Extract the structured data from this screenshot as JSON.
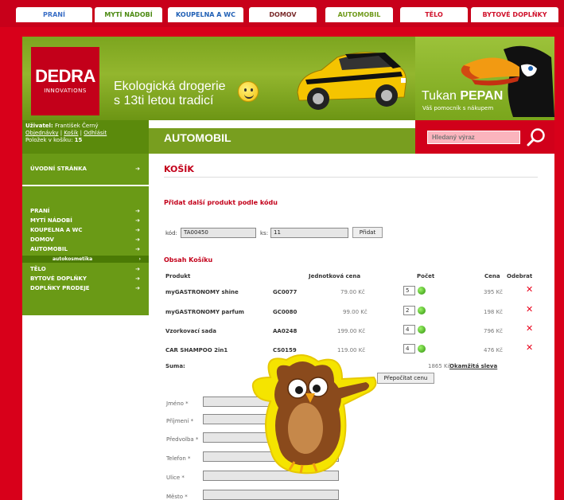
{
  "top_nav": [
    {
      "label": "PRANÍ",
      "color": "#3b6fc6"
    },
    {
      "label": "MYTÍ NÁDOBÍ",
      "color": "#4c8a12"
    },
    {
      "label": "KOUPELNA A WC",
      "color": "#1f5fb5"
    },
    {
      "label": "DOMOV",
      "color": "#7a2b2b"
    },
    {
      "label": "AUTOMOBIL",
      "color": "#6f9a1a"
    },
    {
      "label": "TĚLO",
      "color": "#d0112b"
    },
    {
      "label": "BYTOVÉ DOPLŇKY",
      "color": "#d0112b"
    }
  ],
  "logo": {
    "brand": "DEDRA",
    "sub": "INNOVATIONS"
  },
  "slogan": {
    "line1": "Ekologická drogerie",
    "line2": "s 13ti letou tradicí"
  },
  "toucan": {
    "title_light": "Tukan ",
    "title_bold": "PEPAN",
    "subtitle": "Váš pomocník s nákupem"
  },
  "user": {
    "label": "Uživatel:",
    "name": "František Černý",
    "links": [
      "Objednávky",
      "Košík",
      "Odhlásit"
    ],
    "cart_label": "Položek v košíku:",
    "cart_count": "15"
  },
  "section_title": "AUTOMOBIL",
  "search": {
    "placeholder": "Hledaný výraz"
  },
  "sidebar": {
    "home": "ÚVODNÍ STRÁNKA",
    "items": [
      "PRANÍ",
      "MYTÍ NÁDOBÍ",
      "KOUPELNA A WC",
      "DOMOV",
      "AUTOMOBIL"
    ],
    "subitem": "autokosmetika",
    "items2": [
      "TĚLO",
      "BYTOVÉ DOPLŇKY",
      "DOPLŇKY PRODEJE"
    ],
    "arrow": "➔"
  },
  "cart": {
    "title": "KOŠÍK",
    "add_heading": "Přidat další produkt podle kódu",
    "code_label": "kód:",
    "code_value": "TA00450",
    "qty_label": "ks:",
    "qty_value": "11",
    "add_button": "Přidat",
    "contents_heading": "Obsah Košíku",
    "headers": {
      "product": "Produkt",
      "unit_price": "Jednotková cena",
      "count": "Počet",
      "price": "Cena",
      "remove": "Odebrat"
    },
    "rows": [
      {
        "name": "myGASTRONOMY shine",
        "code": "GC0077",
        "unit": "79.00 Kč",
        "qty": "5",
        "price": "395 Kč"
      },
      {
        "name": "myGASTRONOMY parfum",
        "code": "GC0080",
        "unit": "99.00 Kč",
        "qty": "2",
        "price": "198 Kč"
      },
      {
        "name": "Vzorkovací sada",
        "code": "AA0248",
        "unit": "199.00 Kč",
        "qty": "4",
        "price": "796 Kč"
      },
      {
        "name": "CAR SHAMPOO 2in1",
        "code": "CS0159",
        "unit": "119.00 Kč",
        "qty": "4",
        "price": "476 Kč"
      }
    ],
    "remove_glyph": "✕",
    "sum_label": "Suma:",
    "sum_value": "1865 Kč",
    "discount_link": "Okamžitá sleva",
    "recalc_button": "Přepočítat cenu"
  },
  "form": {
    "fields": [
      "Jméno *",
      "Příjmení *",
      "Předvolba *",
      "Telefon *",
      "Ulice *",
      "Město *"
    ]
  }
}
